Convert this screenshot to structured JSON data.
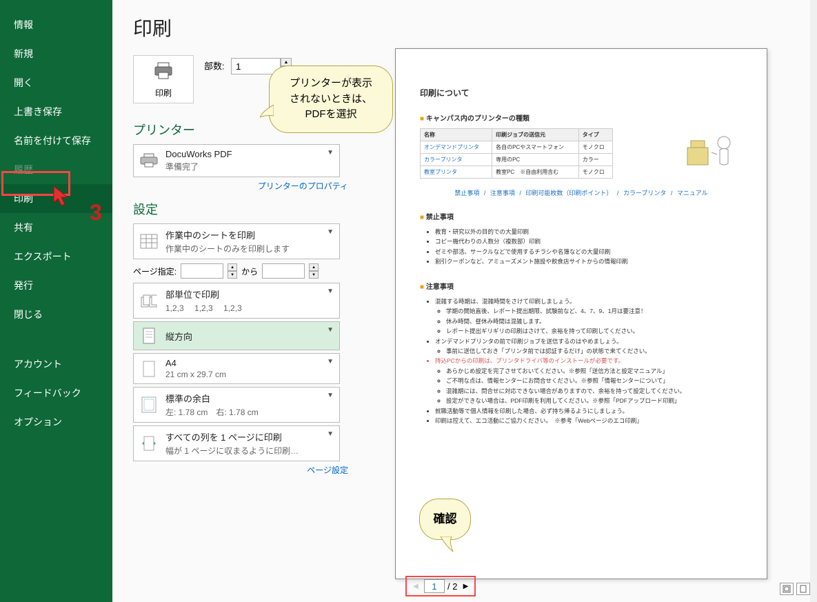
{
  "sidebar": {
    "items": [
      {
        "label": "情報"
      },
      {
        "label": "新規"
      },
      {
        "label": "開く"
      },
      {
        "label": "上書き保存"
      },
      {
        "label": "名前を付けて保存"
      },
      {
        "label": "履歴",
        "disabled": true
      },
      {
        "label": "印刷",
        "active": true
      },
      {
        "label": "共有"
      },
      {
        "label": "エクスポート"
      },
      {
        "label": "発行"
      },
      {
        "label": "閉じる"
      }
    ],
    "items2": [
      {
        "label": "アカウント"
      },
      {
        "label": "フィードバック"
      },
      {
        "label": "オプション"
      }
    ]
  },
  "title": "印刷",
  "print_button": "印刷",
  "copies": {
    "label": "部数:",
    "value": "1"
  },
  "printer_heading": "プリンター",
  "printer": {
    "name": "DocuWorks PDF",
    "status": "準備完了"
  },
  "printer_props_link": "プリンターのプロパティ",
  "settings_heading": "設定",
  "settings": {
    "scope": {
      "title": "作業中のシートを印刷",
      "sub": "作業中のシートのみを印刷します"
    },
    "page_range": {
      "label": "ページ指定:",
      "from": "",
      "to_label": "から",
      "to": ""
    },
    "collate": {
      "title": "部単位で印刷",
      "sub": "1,2,3　 1,2,3　 1,2,3"
    },
    "orientation": {
      "title": "縦方向"
    },
    "paper": {
      "title": "A4",
      "sub": "21 cm x 29.7 cm"
    },
    "margins": {
      "title": "標準の余白",
      "sub": "左: 1.78 cm　右: 1.78 cm"
    },
    "scaling": {
      "title": "すべての列を 1 ページに印刷",
      "sub": "幅が 1 ページに収まるように印刷…"
    }
  },
  "page_setup_link": "ページ設定",
  "callout1": {
    "line1": "プリンターが表示",
    "line2": "されないときは、",
    "line3": "PDFを選択"
  },
  "callout2": "確認",
  "annotation_number": "3",
  "page_nav": {
    "current": "1",
    "total": "2"
  },
  "preview": {
    "title": "印刷について",
    "sec1": "キャンパス内のプリンターの種類",
    "table": {
      "headers": [
        "名称",
        "印刷ジョブの送信元",
        "タイプ"
      ],
      "rows": [
        [
          "オンデマンドプリンタ",
          "各自のPCやスマートフォン",
          "モノクロ"
        ],
        [
          "カラープリンタ",
          "専用のPC",
          "カラー"
        ],
        [
          "教室プリンタ",
          "教室PC　※自由利用含む",
          "モノクロ"
        ]
      ]
    },
    "nav_links": [
      "禁止事項",
      "注意事項",
      "印刷可能枚数（印刷ポイント）",
      "カラープリンタ",
      "マニュアル"
    ],
    "sec2": "禁止事項",
    "list2": [
      "教育・研究以外の目的での大量印刷",
      "コピー機代わりの人数分（複数部）印刷",
      "ゼミや部活、サークルなどで使用するチラシや名簿などの大量印刷",
      "割引クーポンなど、アミューズメント施設や飲食店サイトからの情報印刷"
    ],
    "sec3": "注意事項",
    "list3": [
      "混雑する時期は、混雑時間をさけて印刷しましょう。",
      "学期の開始直後、レポート提出期限、試験前など、4、7、9、1月は要注意！",
      "休み時間、昼休み時間は混雑します。",
      "レポート提出ギリギリの印刷はさけて、余裕を持って印刷してください。",
      "オンデマンドプリンタの前で印刷ジョブを送信するのはやめましょう。",
      "事前に送信しておき「プリンタ前では認証するだけ」の状態で来てください。",
      "持込PCからの印刷は、プリンタドライバ等のインストールが必要です。",
      "あらかじめ設定を完了させておいてください。※参照「送信方法と設定マニュアル」",
      "ご不明な点は、情報センターにお問合せください。※参照「情報センターについて」",
      "混雑期には、問合せに対応できない場合がありますので、余裕を持って設定してください。",
      "設定ができない場合は、PDF印刷を利用してください。※参照「PDFアップロード印刷」",
      "就職活動等で個人情報を印刷した場合、必ず持ち帰るようにしましょう。",
      "印刷は控えて、エコ活動にご協力ください。　※参考「Webページのエコ印刷」"
    ]
  }
}
